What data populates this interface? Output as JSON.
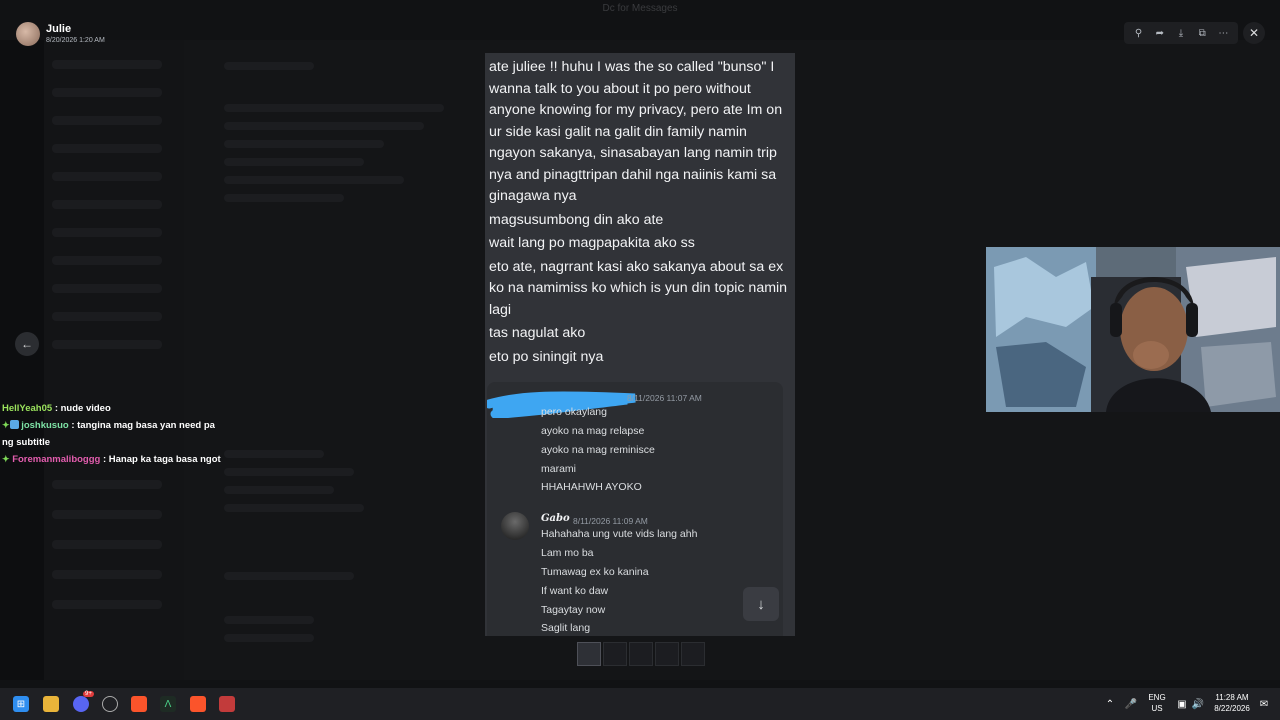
{
  "viewer": {
    "window_title": "Dc for Messages",
    "user_name": "Julie",
    "timestamp": "8/20/2026 1:20 AM",
    "tools": [
      "zoom-icon",
      "forward-icon",
      "download-icon",
      "open-external-icon",
      "more-icon"
    ]
  },
  "live_chat": [
    {
      "name": "HellYeah05",
      "text": ": nude video"
    },
    {
      "name": "joshkusuo",
      "text": ": tangina mag basa yan need pa ng subtitle"
    },
    {
      "name": "Foremanmaliboggg",
      "text": ": Hanap ka taga basa ngot"
    }
  ],
  "image_messages": [
    "ate juliee !! huhu I was the so called \"bunso\" I wanna talk to you about it po pero without anyone knowing for my privacy, pero ate Im on ur side kasi galit na galit din family namin ngayon sakanya, sinasabayan lang namin trip nya and pinagttripan dahil nga naiinis kami sa ginagawa nya",
    "magsusumbong din ako ate",
    "wait lang po magpapakita ako ss",
    "eto ate, nagrrant kasi ako sakanya about sa ex ko na namimiss ko which is yun din topic namin lagi",
    "tas nagulat ako",
    "eto po siningit nya"
  ],
  "embedded": {
    "first_date": "8/11/2026 11:07 AM",
    "first_lines": [
      "pero okaylang",
      "ayoko na mag relapse",
      "ayoko na mag reminisce",
      "marami",
      "HHAHAHWH AYOKO"
    ],
    "second_name": "Gabo",
    "second_date": "8/11/2026 11:09 AM",
    "second_lines": [
      "Hahahaha ung vute vids lang ahh",
      "Lam mo ba",
      "Tumawag ex ko kanina",
      "If want ko daw",
      "Tagaytay now",
      "Saglit lang"
    ]
  },
  "taskbar": {
    "discord_badge": "9+",
    "lang_top": "ENG",
    "lang_bottom": "US",
    "time": "11:28 AM",
    "date": "8/22/2026"
  },
  "colors": {
    "scribble": "#3ea6f2",
    "chat_name_1": "#9be35d",
    "chat_name_2": "#7ee3a6",
    "chat_name_3": "#e35dae"
  }
}
